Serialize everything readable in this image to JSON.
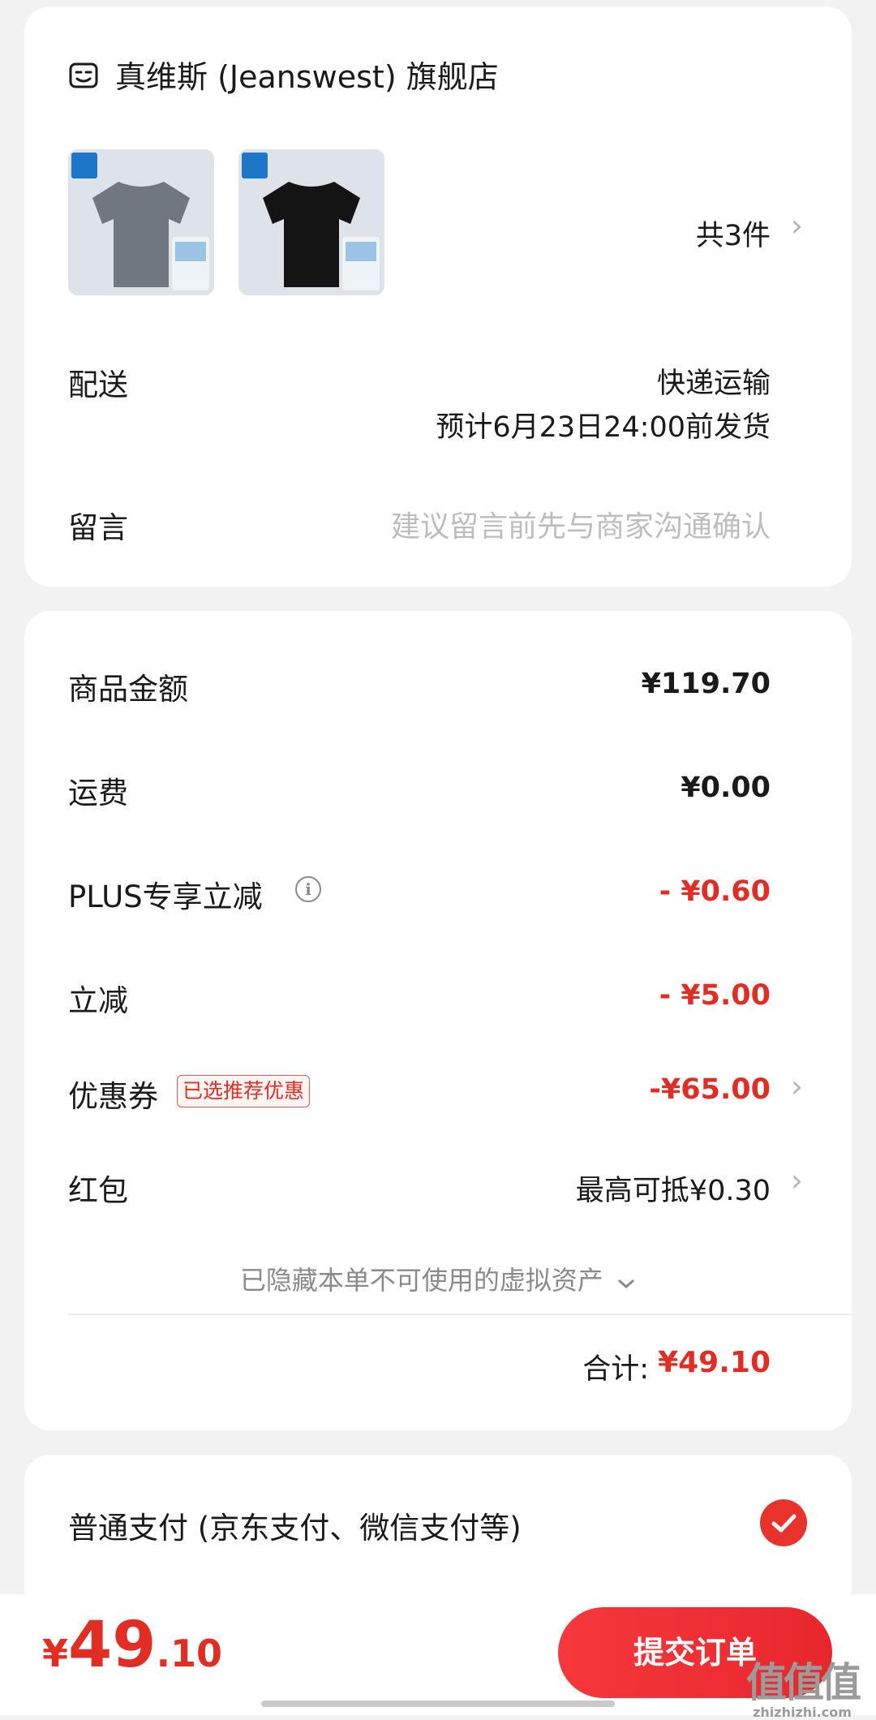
{
  "store": {
    "name": "真维斯 (Jeanswest) 旗舰店",
    "icon": "store-icon",
    "products": [
      {
        "color": "#6f7880",
        "brand_tag": "Jeans west",
        "caption": "全方位时尚"
      },
      {
        "color": "#141414",
        "brand_tag": "Jeans west",
        "caption": "全方位时尚"
      }
    ],
    "count_label": "共3件"
  },
  "delivery": {
    "label": "配送",
    "method": "快递运输",
    "eta": "预计6月23日24:00前发货"
  },
  "message": {
    "label": "留言",
    "placeholder": "建议留言前先与商家沟通确认"
  },
  "fees": {
    "goods_label": "商品金额",
    "goods_value": "¥119.70",
    "shipping_label": "运费",
    "shipping_value": "¥0.00",
    "plus_label": "PLUS专享立减",
    "plus_value": "- ¥0.60",
    "instant_label": "立减",
    "instant_value": "- ¥5.00",
    "coupon_label": "优惠券",
    "coupon_badge": "已选推荐优惠",
    "coupon_value": "-¥65.00",
    "redpacket_label": "红包",
    "redpacket_value": "最高可抵¥0.30",
    "hidden_assets": "已隐藏本单不可使用的虚拟资产",
    "total_label": "合计:",
    "total_value": "¥49.10"
  },
  "payment": {
    "label": "普通支付 (京东支付、微信支付等)",
    "selected": true
  },
  "bottom": {
    "currency": "¥",
    "price_int": "49",
    "price_dec": ".10",
    "submit_label": "提交订单"
  },
  "watermark": {
    "big": "值值值",
    "small": "zhizhizhi.com"
  },
  "colors": {
    "accent": "#e02e24",
    "button": "#f5383c",
    "background": "#f2f2f2"
  }
}
